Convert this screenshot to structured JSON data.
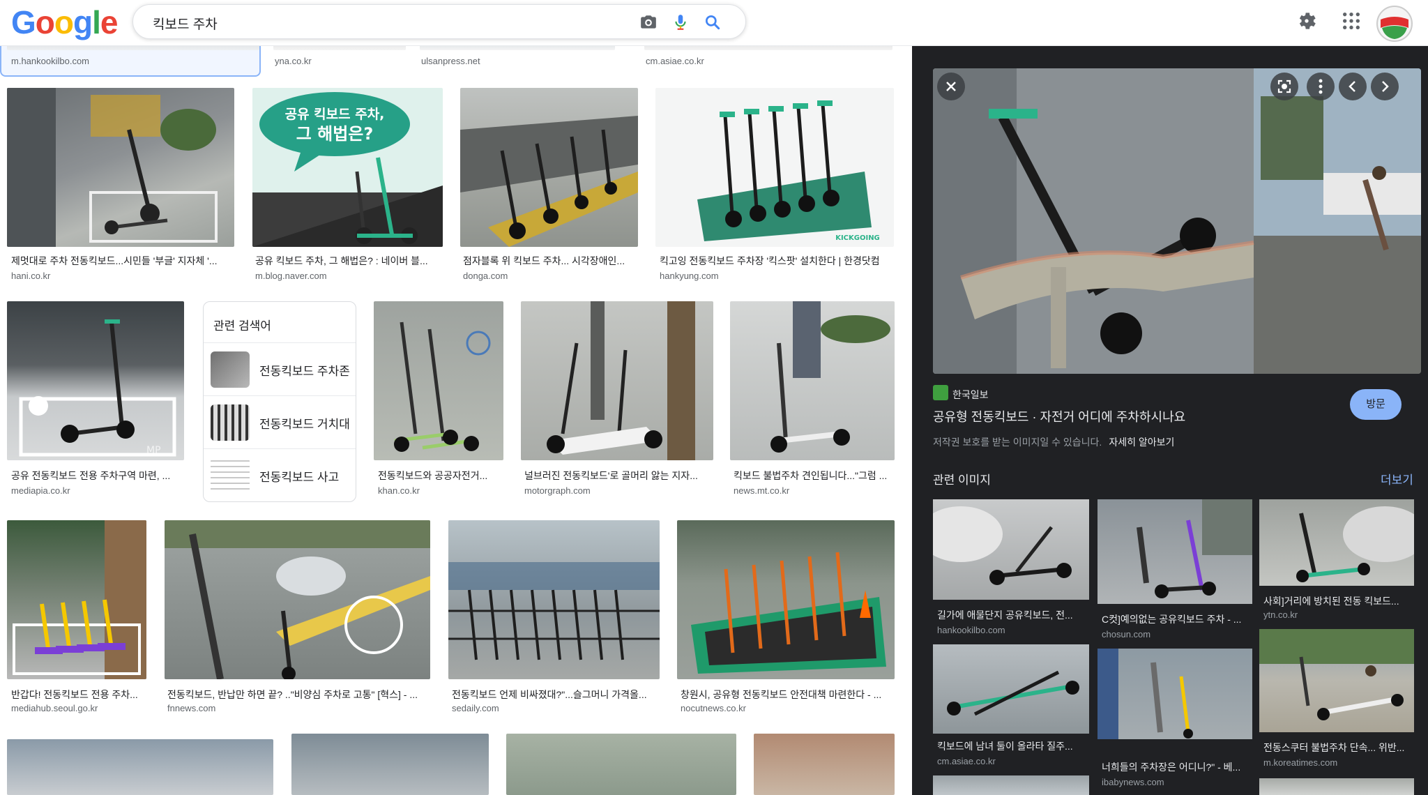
{
  "logo": {
    "g1": "G",
    "o1": "o",
    "o2": "o",
    "g2": "g",
    "l": "l",
    "e": "e"
  },
  "search": {
    "query": "킥보드 주차"
  },
  "top_row": [
    {
      "source": "m.hankookilbo.com"
    },
    {
      "source": "yna.co.kr"
    },
    {
      "source": "ulsanpress.net"
    },
    {
      "source": "cm.asiae.co.kr"
    }
  ],
  "row1": [
    {
      "caption": "제멋대로 주차 전동킥보드...시민들 '부글' 지자체 '...",
      "source": "hani.co.kr"
    },
    {
      "caption": "공유 킥보드 주차, 그 해법은? : 네이버 블...",
      "source": "m.blog.naver.com"
    },
    {
      "caption": "점자블록 위 킥보드 주차... 시각장애인...",
      "source": "donga.com"
    },
    {
      "caption": "킥고잉 전동킥보드 주차장 '킥스팟' 설치한다 | 한경닷컴",
      "source": "hankyung.com"
    }
  ],
  "row1_image_text": {
    "bubble_line1": "공유 킥보드 주차,",
    "bubble_line2": "그 해법은?",
    "brand": "KICKGOING"
  },
  "row2": [
    {
      "caption": "공유 전동킥보드 전용 주차구역 마련, ...",
      "source": "mediapia.co.kr"
    },
    {
      "caption": "전동킥보드와 공공자전거...",
      "source": "khan.co.kr"
    },
    {
      "caption": "널브러진 전동킥보드'로 골머리 앓는 지자...",
      "source": "motorgraph.com"
    },
    {
      "caption": "킥보드 불법주차 견인됩니다...\"그럼 ...",
      "source": "news.mt.co.kr"
    }
  ],
  "related_searches": {
    "heading": "관련 검색어",
    "items": [
      {
        "label": "전동킥보드 주차존"
      },
      {
        "label": "전동킥보드 거치대"
      },
      {
        "label": "전동킥보드 사고"
      }
    ]
  },
  "row3": [
    {
      "caption": "반갑다! 전동킥보드 전용 주차...",
      "source": "mediahub.seoul.go.kr"
    },
    {
      "caption": "전동킥보드, 반납만 하면 끝? ..\"비양심 주차로 고통\" [혁스] - ...",
      "source": "fnnews.com"
    },
    {
      "caption": "전동킥보드 언제 비싸졌대?\"...슬그머니 가격올...",
      "source": "sedaily.com"
    },
    {
      "caption": "창원시, 공유형 전동킥보드 안전대책 마련한다 - ...",
      "source": "nocutnews.co.kr"
    }
  ],
  "panel": {
    "source_name": "한국일보",
    "title": "공유형 전동킥보드 · 자전거 어디에 주차하시나요",
    "copyright": "저작권 보호를 받는 이미지일 수 있습니다.",
    "learn_more": "자세히 알아보기",
    "visit_label": "방문",
    "related_heading": "관련 이미지",
    "more_label": "더보기",
    "related": [
      {
        "caption": "길가에 애물단지 공유킥보드, 전...",
        "source": "hankookilbo.com"
      },
      {
        "caption": "C컷]예의없는 공유킥보드 주차 - ...",
        "source": "chosun.com"
      },
      {
        "caption": "사회]거리에 방치된 전동 킥보드...",
        "source": "ytn.co.kr"
      },
      {
        "caption": "킥보드에 남녀 둘이 올라타 질주...",
        "source": "cm.asiae.co.kr"
      },
      {
        "caption": "너희들의 주차장은 어디니?\" - 베...",
        "source": "ibabynews.com"
      },
      {
        "caption": "전동스쿠터 불법주차 단속... 위반...",
        "source": "m.koreatimes.com"
      }
    ]
  },
  "colors": {
    "accent": "#8ab4f8",
    "panel_bg": "#202124",
    "scooter_green": "#2bb38a"
  },
  "icons": [
    "camera-icon",
    "mic-icon",
    "search-icon",
    "gear-icon",
    "apps-grid-icon",
    "close-icon",
    "lens-icon",
    "more-vert-icon",
    "chevron-left-icon",
    "chevron-right-icon"
  ]
}
